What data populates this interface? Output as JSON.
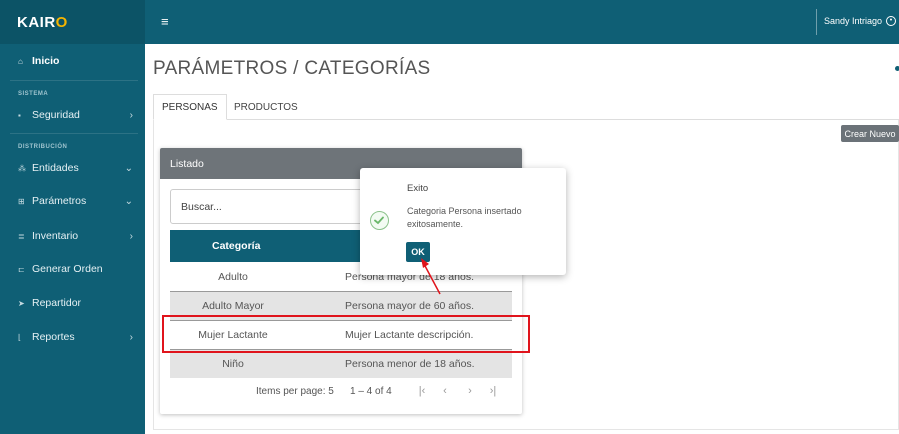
{
  "brand": {
    "prefix": "KAIR",
    "suffix": "O"
  },
  "topbar": {
    "menu_icon": "hamburger-icon",
    "user_name": "Sandy Intriago",
    "user_icon": "user-circle-icon"
  },
  "sidebar": {
    "home": {
      "label": "Inicio",
      "icon": "home-icon"
    },
    "section_sistema": "SISTEMA",
    "seguridad": {
      "label": "Seguridad",
      "icon": "lock-icon",
      "chevron": "›"
    },
    "section_distribucion": "DISTRIBUCIÓN",
    "entidades": {
      "label": "Entidades",
      "icon": "users-icon",
      "chevron": "⌄"
    },
    "parametros": {
      "label": "Parámetros",
      "icon": "sitemap-icon",
      "chevron": "⌄"
    },
    "inventario": {
      "label": "Inventario",
      "icon": "list-icon",
      "chevron": "›"
    },
    "generar_orden": {
      "label": "Generar Orden",
      "icon": "cart-icon"
    },
    "repartidor": {
      "label": "Repartidor",
      "icon": "send-icon"
    },
    "reportes": {
      "label": "Reportes",
      "icon": "chart-icon",
      "chevron": "›"
    }
  },
  "main": {
    "title": "PARÁMETROS / CATEGORÍAS",
    "tabs": [
      {
        "label": "PERSONAS"
      },
      {
        "label": "PRODUCTOS"
      }
    ],
    "create_button": "Crear Nuevo"
  },
  "list": {
    "header": "Listado",
    "search_value": "Buscar...",
    "column_category": "Categoría",
    "rows": [
      {
        "category": "Adulto",
        "description": "Persona mayor de 18 años."
      },
      {
        "category": "Adulto Mayor",
        "description": "Persona mayor de 60 años."
      },
      {
        "category": "Mujer Lactante",
        "description": "Mujer Lactante descripción."
      },
      {
        "category": "Niño",
        "description": "Persona menor de 18 años."
      }
    ],
    "items_per_page_label": "Items per page:",
    "items_per_page_value": "5",
    "range": "1 – 4 of 4"
  },
  "dialog": {
    "title": "Exito",
    "message": "Categoria Persona insertado exitosamente.",
    "ok_label": "OK",
    "icon": "check-circle-icon"
  },
  "colors": {
    "primary": "#0f5f75",
    "accent": "#f4b400",
    "highlight": "#e0141c",
    "button_gray": "#6b7278"
  }
}
